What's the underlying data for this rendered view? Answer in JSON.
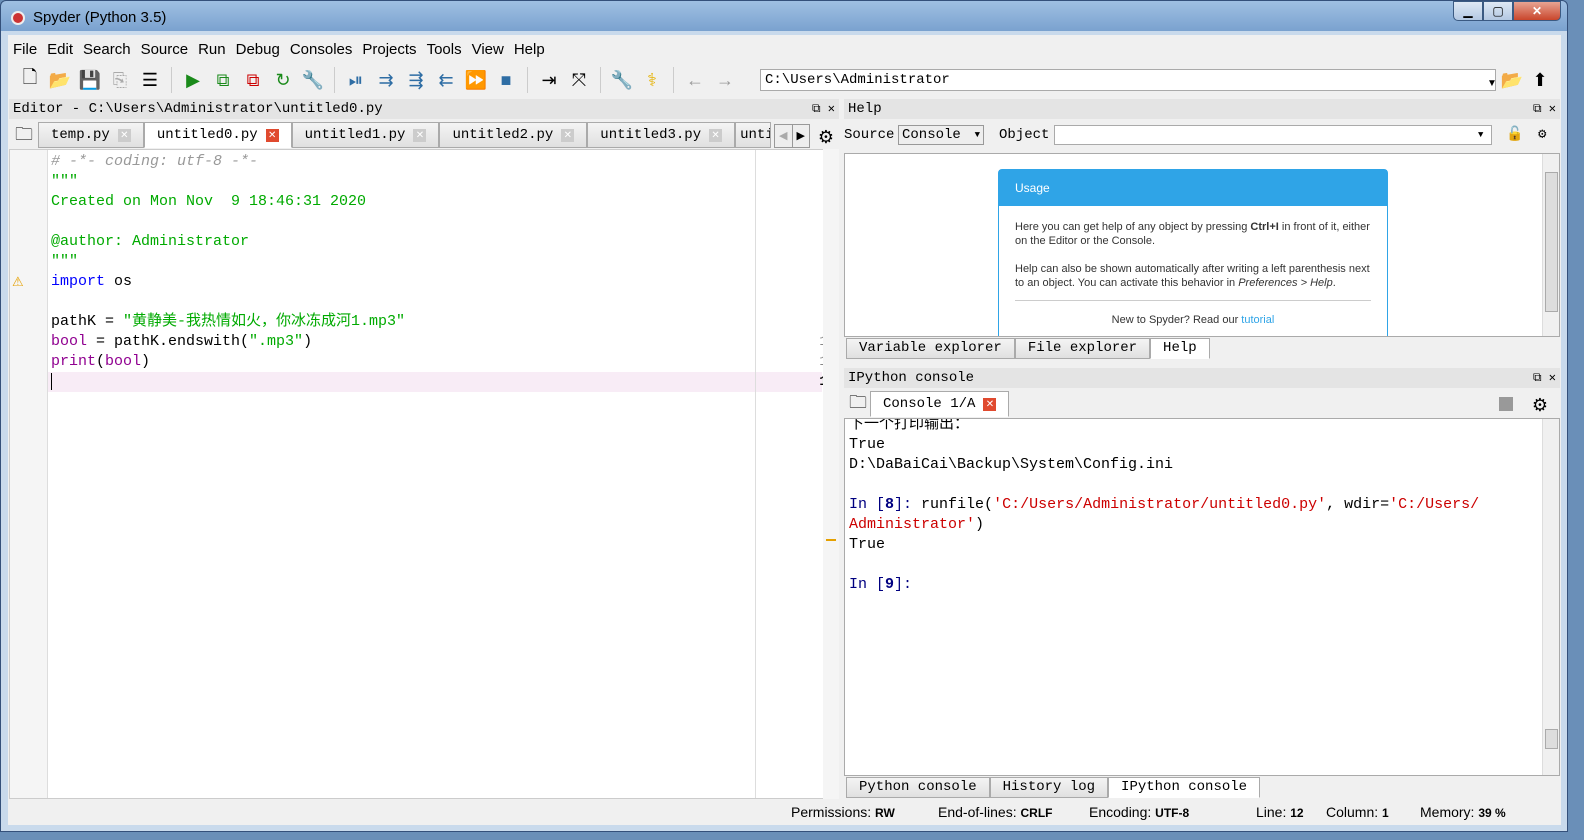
{
  "window": {
    "title": "Spyder (Python 3.5)"
  },
  "menu": [
    "File",
    "Edit",
    "Search",
    "Source",
    "Run",
    "Debug",
    "Consoles",
    "Projects",
    "Tools",
    "View",
    "Help"
  ],
  "toolbar": {
    "path": "C:\\Users\\Administrator"
  },
  "editor": {
    "header": "Editor - C:\\Users\\Administrator\\untitled0.py",
    "tabs": [
      {
        "label": "temp.py"
      },
      {
        "label": "untitled0.py",
        "active": true
      },
      {
        "label": "untitled1.py"
      },
      {
        "label": "untitled2.py"
      },
      {
        "label": "untitled3.py"
      },
      {
        "label": "unti"
      }
    ],
    "lines": [
      "# -*- coding: utf-8 -*-",
      "\"\"\"",
      "Created on Mon Nov  9 18:46:31 2020",
      "",
      "@author: Administrator",
      "\"\"\"",
      "import os",
      "",
      "pathK = \"黄静美-我热情如火，你冰冻成河1.mp3\"",
      "bool = pathK.endswith(\".mp3\")",
      "print(bool)",
      ""
    ],
    "current_line": 12,
    "warning_line": 7
  },
  "help": {
    "header": "Help",
    "source_label": "Source",
    "source_value": "Console",
    "object_label": "Object",
    "object_value": "",
    "usage_title": "Usage",
    "p1a": "Here you can get help of any object by pressing ",
    "p1b": "Ctrl+I",
    "p1c": " in front of it, either on the Editor or the Console.",
    "p2a": "Help can also be shown automatically after writing a left parenthesis next to an object. You can activate this behavior in ",
    "p2b": "Preferences > Help",
    ".p2c": ".",
    "p3a": "New to Spyder? Read our ",
    "p3b": "tutorial",
    "tabs": [
      "Variable explorer",
      "File explorer",
      "Help"
    ]
  },
  "console": {
    "header": "IPython console",
    "tab": "Console 1/A",
    "lines": {
      "l0": "下一个打印输出：",
      "l1": "True",
      "l2": "D:\\DaBaiCai\\Backup\\System\\Config.ini",
      "in8a": "In [",
      "in8n": "8",
      "in8b": "]: ",
      "run": "runfile(",
      "arg1": "'C:/Users/Administrator/untitled0.py'",
      "comma": ", wdir=",
      "arg2a": "'C:/Users/",
      "arg2b": "Administrator'",
      "close": ")",
      "l5": "True",
      "in9a": "In [",
      "in9n": "9",
      "in9b": "]:"
    },
    "tabs": [
      "Python console",
      "History log",
      "IPython console"
    ]
  },
  "status": {
    "permissions_label": "Permissions:",
    "permissions": "RW",
    "eol_label": "End-of-lines:",
    "eol": "CRLF",
    "encoding_label": "Encoding:",
    "encoding": "UTF-8",
    "line_label": "Line:",
    "line": "12",
    "column_label": "Column:",
    "column": "1",
    "memory_label": "Memory:",
    "memory": "39 %"
  }
}
